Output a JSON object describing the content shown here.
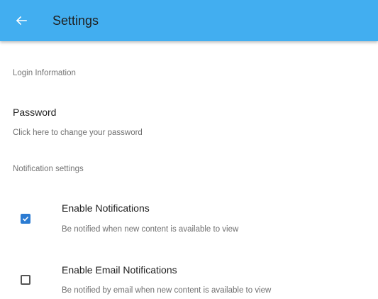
{
  "appbar": {
    "title": "Settings",
    "back_icon": "arrow-left-icon",
    "color": "#42aef0"
  },
  "login_section": {
    "header": "Login Information",
    "password": {
      "title": "Password",
      "summary": "Click here to change your password"
    }
  },
  "notification_section": {
    "header": "Notification settings",
    "enable_notifications": {
      "title": "Enable Notifications",
      "summary": "Be notified when new content is available to view",
      "checked": true
    },
    "enable_email_notifications": {
      "title": "Enable Email Notifications",
      "summary": "Be notified by email when new content is available to view",
      "checked": false
    }
  },
  "accent_color": "#2b7bd2"
}
